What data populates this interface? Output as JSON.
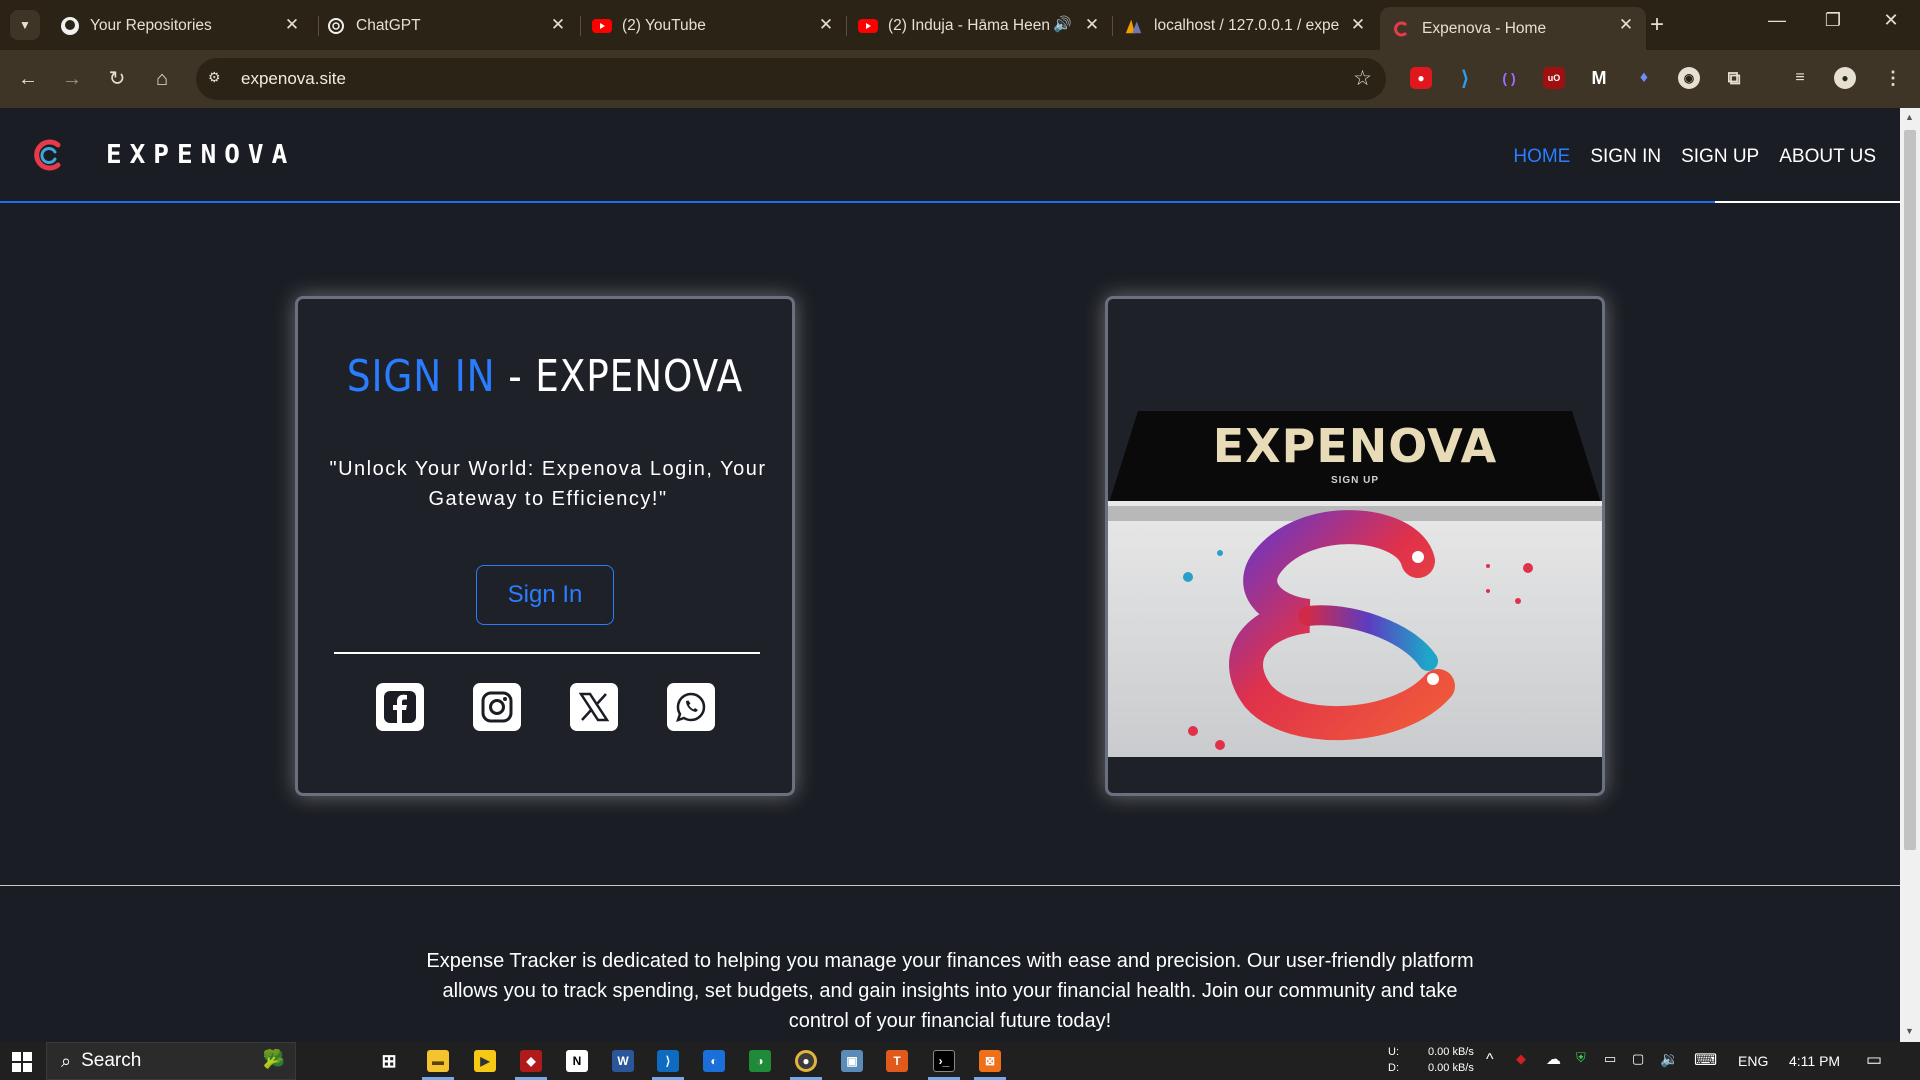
{
  "browser": {
    "tabs": [
      {
        "title": "Your Repositories",
        "icon": "github-icon"
      },
      {
        "title": "ChatGPT",
        "icon": "chatgpt-icon"
      },
      {
        "title": "(2) YouTube",
        "icon": "youtube-icon"
      },
      {
        "title": "(2) Induja - Hāma Heen",
        "icon": "youtube-icon"
      },
      {
        "title": "localhost / 127.0.0.1 / expe",
        "icon": "phpmyadmin-icon"
      },
      {
        "title": "Expenova - Home",
        "icon": "expenova-icon",
        "active": true
      }
    ],
    "url": "expenova.site"
  },
  "site": {
    "brand": "EXPENOVA",
    "nav": [
      "HOME",
      "SIGN IN",
      "SIGN UP",
      "ABOUT US"
    ],
    "active_nav": "HOME",
    "accent": "#2a7dff"
  },
  "signin_card": {
    "title_highlight": "SIGN IN",
    "title_rest": " - EXPENOVA",
    "tagline": "\"Unlock Your World: Expenova Login, Your Gateway to Efficiency!\"",
    "button": "Sign In",
    "socials": [
      "facebook-icon",
      "instagram-icon",
      "x-icon",
      "whatsapp-icon"
    ]
  },
  "image_card": {
    "poster_title": "EXPENOVA",
    "poster_subtitle": "SIGN UP"
  },
  "about": {
    "text": "Expense Tracker is dedicated to helping you manage your finances with ease and precision. Our user-friendly platform allows you to track spending, set budgets, and gain insights into your financial health. Join our community and take control of your financial future today!"
  },
  "taskbar": {
    "search_label": "Search",
    "net_up_label": "U:",
    "net_down_label": "D:",
    "net_up": "0.00 kB/s",
    "net_down": "0.00 kB/s",
    "language": "ENG",
    "time": "4:11 PM"
  }
}
